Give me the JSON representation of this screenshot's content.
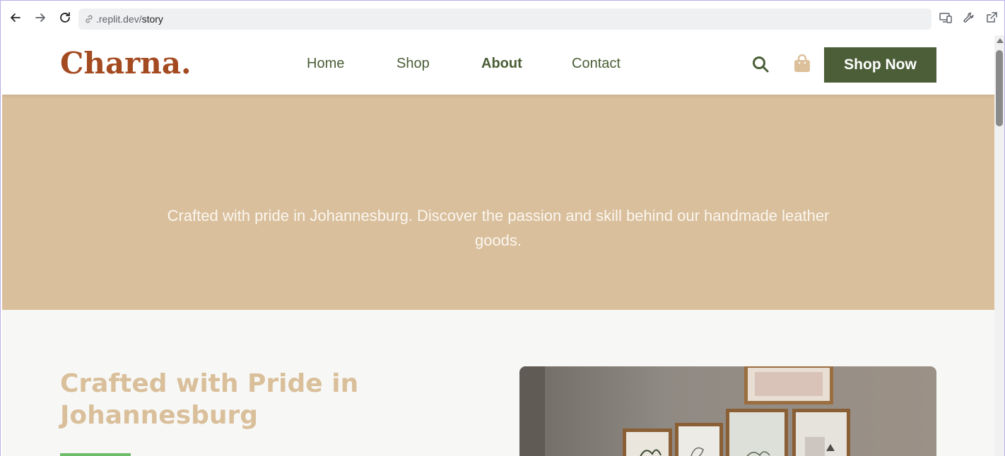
{
  "browser": {
    "url_prefix": ".replit.dev/",
    "url_path": "story"
  },
  "header": {
    "logo": "Charna.",
    "nav": [
      "Home",
      "Shop",
      "About",
      "Contact"
    ],
    "active_nav": "About",
    "cta_label": "Shop Now"
  },
  "hero": {
    "text": "Crafted with pride in Johannesburg. Discover the passion and skill behind our handmade leather goods."
  },
  "story": {
    "title": "Crafted with Pride in Johannesburg"
  },
  "colors": {
    "brand": "#a44a20",
    "primary": "#4b5e38",
    "hero_bg": "#d9bf9c",
    "accent": "#6fbd6a"
  },
  "icons": [
    "back-arrow-icon",
    "forward-arrow-icon",
    "reload-icon",
    "link-icon",
    "device-icon",
    "wrench-icon",
    "external-link-icon",
    "search-icon",
    "shopping-bag-icon"
  ]
}
